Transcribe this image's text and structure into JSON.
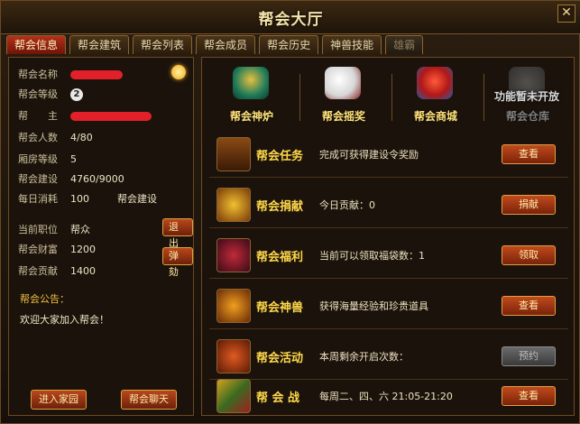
{
  "window": {
    "title": "帮会大厅",
    "close": "✕"
  },
  "tabs": [
    {
      "label": "帮会信息",
      "active": true
    },
    {
      "label": "帮会建筑"
    },
    {
      "label": "帮会列表"
    },
    {
      "label": "帮会成员"
    },
    {
      "label": "帮会历史"
    },
    {
      "label": "神兽技能"
    },
    {
      "label": "雄霸"
    }
  ],
  "info": {
    "name_label": "帮会名称",
    "level_label": "帮会等级",
    "level": "2",
    "leader_label": "帮　　主",
    "members_label": "帮会人数",
    "members": "4/80",
    "wing_label": "厢房等级",
    "wing": "5",
    "build_label": "帮会建设",
    "build": "4760/9000",
    "daily_label": "每日消耗",
    "daily": "100",
    "daily_unit": "帮会建设",
    "position_label": "当前职位",
    "position": "帮众",
    "wealth_label": "帮会财富",
    "wealth": "1200",
    "contrib_label": "帮会贡献",
    "contrib": "1400",
    "quit": "退出",
    "impeach": "弹劾",
    "notice_label": "帮会公告：",
    "notice": "欢迎大家加入帮会！",
    "home_btn": "进入家园",
    "chat_btn": "帮会聊天"
  },
  "icons": [
    {
      "label": "帮会神炉"
    },
    {
      "label": "帮会摇奖"
    },
    {
      "label": "帮会商城"
    },
    {
      "label": "帮会仓库",
      "note": "功能暂未开放"
    }
  ],
  "features": [
    {
      "name": "帮会任务",
      "desc": "完成可获得建设令奖励",
      "button": "查看"
    },
    {
      "name": "帮会捐献",
      "desc": "今日贡献：0",
      "button": "捐献"
    },
    {
      "name": "帮会福利",
      "desc": "当前可以领取福袋数：1",
      "button": "领取"
    },
    {
      "name": "帮会神兽",
      "desc": "获得海量经验和珍贵道具",
      "button": "查看"
    },
    {
      "name": "帮会活动",
      "desc": "本周剩余开启次数：",
      "button": "预约"
    },
    {
      "name": "帮 会 战",
      "desc": "每周二、四、六 21:05-21:20",
      "button": "查看"
    }
  ]
}
